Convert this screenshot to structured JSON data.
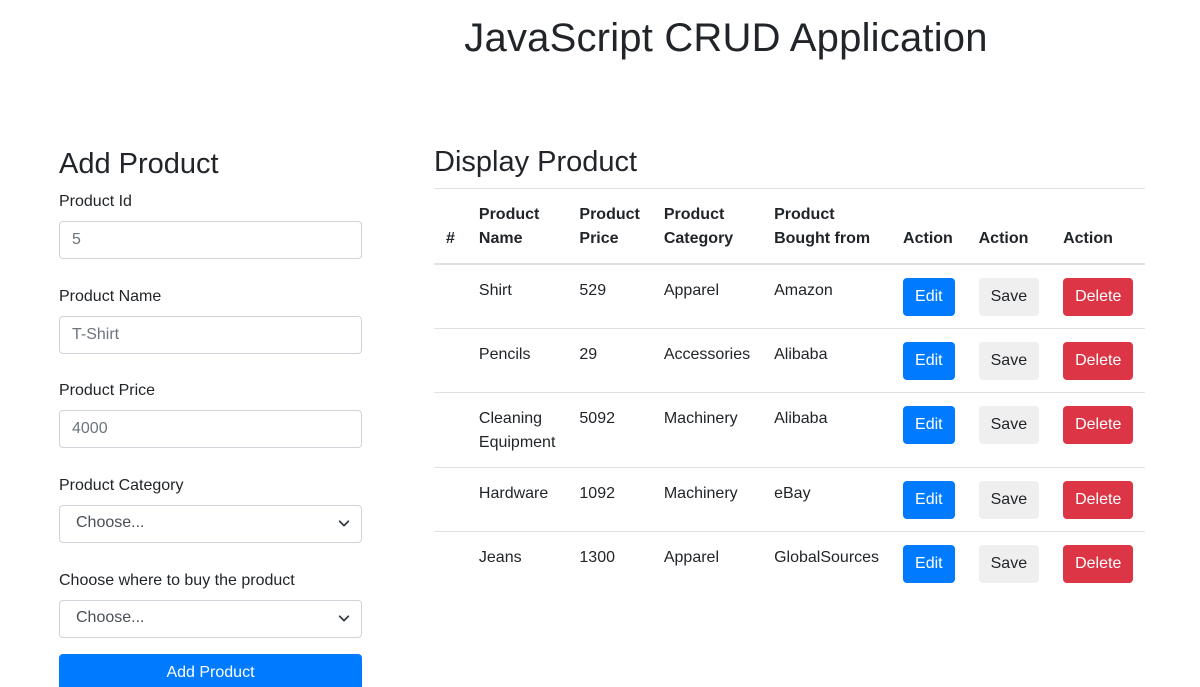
{
  "app": {
    "title": "JavaScript CRUD Application"
  },
  "form": {
    "title": "Add Product",
    "product_id": {
      "label": "Product Id",
      "placeholder": "5"
    },
    "product_name": {
      "label": "Product Name",
      "placeholder": "T-Shirt"
    },
    "product_price": {
      "label": "Product Price",
      "placeholder": "4000"
    },
    "product_category": {
      "label": "Product Category",
      "selected": "Choose..."
    },
    "buy_from": {
      "label": "Choose where to buy the product",
      "selected": "Choose..."
    },
    "submit_label": "Add Product"
  },
  "table": {
    "title": "Display Product",
    "headers": [
      "#",
      "Product Name",
      "Product Price",
      "Product Category",
      "Product Bought from",
      "Action",
      "Action",
      "Action"
    ],
    "rows": [
      {
        "index": "",
        "name": "Shirt",
        "price": "529",
        "category": "Apparel",
        "source": "Amazon"
      },
      {
        "index": "",
        "name": "Pencils",
        "price": "29",
        "category": "Accessories",
        "source": "Alibaba"
      },
      {
        "index": "",
        "name": "Cleaning Equipment",
        "price": "5092",
        "category": "Machinery",
        "source": "Alibaba"
      },
      {
        "index": "",
        "name": "Hardware",
        "price": "1092",
        "category": "Machinery",
        "source": "eBay"
      },
      {
        "index": "",
        "name": "Jeans",
        "price": "1300",
        "category": "Apparel",
        "source": "GlobalSources"
      }
    ],
    "actions": {
      "edit": "Edit",
      "save": "Save",
      "delete": "Delete"
    }
  },
  "colors": {
    "primary": "#007bff",
    "danger": "#dc3545",
    "light": "#efefef",
    "text": "#212529"
  }
}
